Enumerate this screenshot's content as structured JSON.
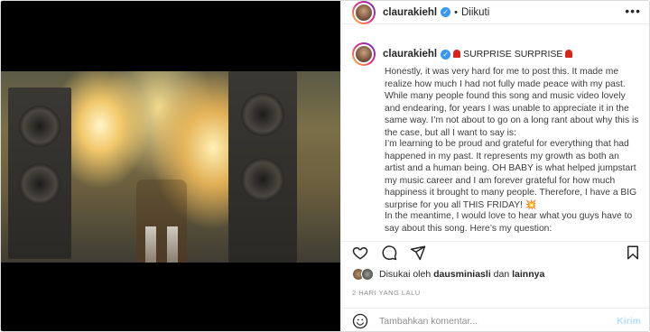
{
  "header": {
    "username": "claurakiehl",
    "separator": "•",
    "follow_status": "Diikuti",
    "more_label": "•••"
  },
  "caption": {
    "username": "claurakiehl",
    "title": "SURPRISE SURPRISE",
    "paragraph1": "Honestly, it was very hard for me to post this. It made me realize how much I had not fully made peace with my past. While many people found this song and music video lovely and endearing, for years I was unable to appreciate it in the same way. I’m not about to go on a long rant about why this is the case, but all I want to say is:",
    "paragraph2": "I’m learning to be proud and grateful for everything that had happened in my past. It represents my growth as both an artist and a human being. OH BABY is what helped jumpstart my music career and I am forever grateful for how much happiness it brought to many people. Therefore, I have a BIG surprise for you all THIS FRIDAY!",
    "paragraph2_emoji": "💥",
    "paragraph3": "In the meantime, I would love to hear what you guys have to say about this song. Here’s my question:"
  },
  "likes": {
    "prefix": "Disukai oleh",
    "user": "dausminiasli",
    "joiner": "dan",
    "others": "lainnya"
  },
  "timestamp": "2 HARI YANG LALU",
  "comment": {
    "placeholder": "Tambahkan komentar...",
    "send_label": "Kirim"
  },
  "colors": {
    "verified": "#3897f0",
    "send_disabled": "#b2dffc",
    "siren": "#d9261c"
  }
}
